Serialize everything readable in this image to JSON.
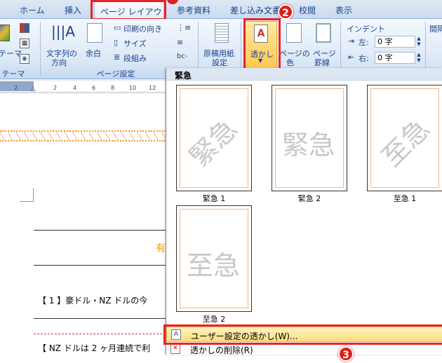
{
  "tabs": {
    "home": "ホーム",
    "insert": "挿入",
    "page_layout": "ページ レイアウト",
    "references": "参考資料",
    "mailings": "差し込み文書",
    "review": "校閲",
    "view": "表示"
  },
  "callouts": {
    "c2": "2",
    "c3": "3"
  },
  "ribbon": {
    "theme_btn": "テーマ",
    "theme_group": "テーマ",
    "text_direction_l1": "文字列の",
    "text_direction_l2": "方向",
    "margins": "余白",
    "orientation": "印刷の向き",
    "size": "サイズ",
    "columns": "段組み",
    "page_setup_group": "ページ設定",
    "manuscript_l1": "原稿用紙",
    "manuscript_l2": "設定",
    "watermark": "透かし",
    "page_color_l1": "ページの",
    "page_color_l2": "色",
    "page_border_l1": "ページ",
    "page_border_l2": "罫線",
    "indent_label": "インデント",
    "indent_left_label": "左:",
    "indent_left_value": "0 字",
    "indent_right_label": "右:",
    "indent_right_value": "0 字",
    "spacing_label": "間隔"
  },
  "ruler": {
    "ticks": [
      "2",
      "2",
      "4",
      "6",
      "8",
      "10",
      "12"
    ]
  },
  "document": {
    "heading_partial": "有",
    "line1": "【 1 】豪ドル・NZ ドルの今",
    "line2": "【 NZ ドルは 2 ヶ月連続で利"
  },
  "watermark_panel": {
    "section_title": "緊急",
    "items": [
      {
        "wm": "緊急",
        "label": "緊急 1"
      },
      {
        "wm": "緊急",
        "label": "緊急 2"
      },
      {
        "wm": "至急",
        "label": "至急 1"
      },
      {
        "wm": "至急",
        "label": "至急 2"
      }
    ],
    "custom": "ユーザー設定の透かし(W)...",
    "remove": "透かしの削除(R)"
  }
}
